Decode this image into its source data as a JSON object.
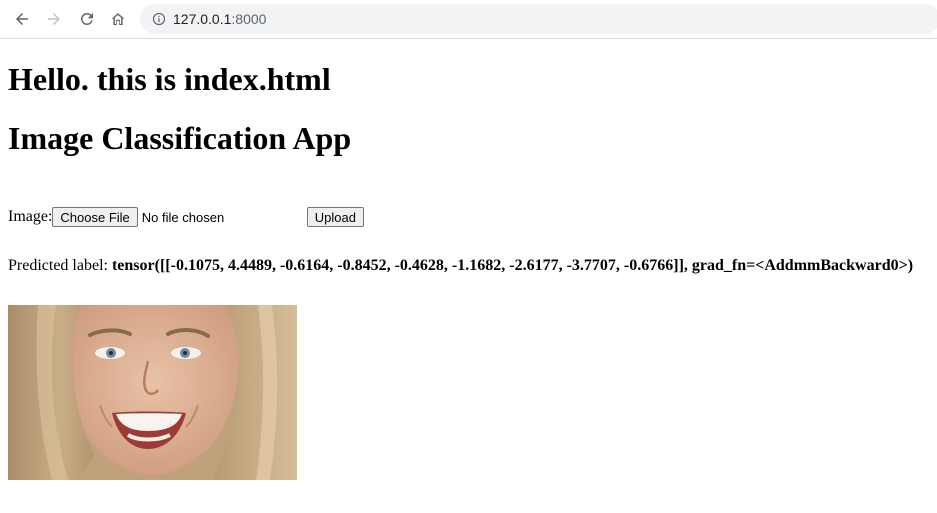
{
  "browser": {
    "url_host": "127.0.0.1",
    "url_port": ":8000"
  },
  "page": {
    "heading1": "Hello. this is index.html",
    "heading2": "Image Classification App",
    "form": {
      "label": "Image:",
      "choose_file_label": "Choose File",
      "file_status": "No file chosen",
      "upload_label": "Upload"
    },
    "prediction": {
      "label": "Predicted label:",
      "value": "tensor([[-0.1075, 4.4489, -0.6164, -0.8452, -0.4628, -1.1682, -2.6177, -3.7707, -0.6766]], grad_fn=<AddmmBackward0>)"
    }
  },
  "colors": {
    "chrome_border": "#dadce0",
    "omnibox_bg": "#f1f3f4",
    "icon": "#5f6368",
    "icon_disabled": "#c1c4c7"
  },
  "icons": [
    "back-arrow-icon",
    "forward-arrow-icon",
    "reload-icon",
    "home-icon",
    "info-icon"
  ]
}
